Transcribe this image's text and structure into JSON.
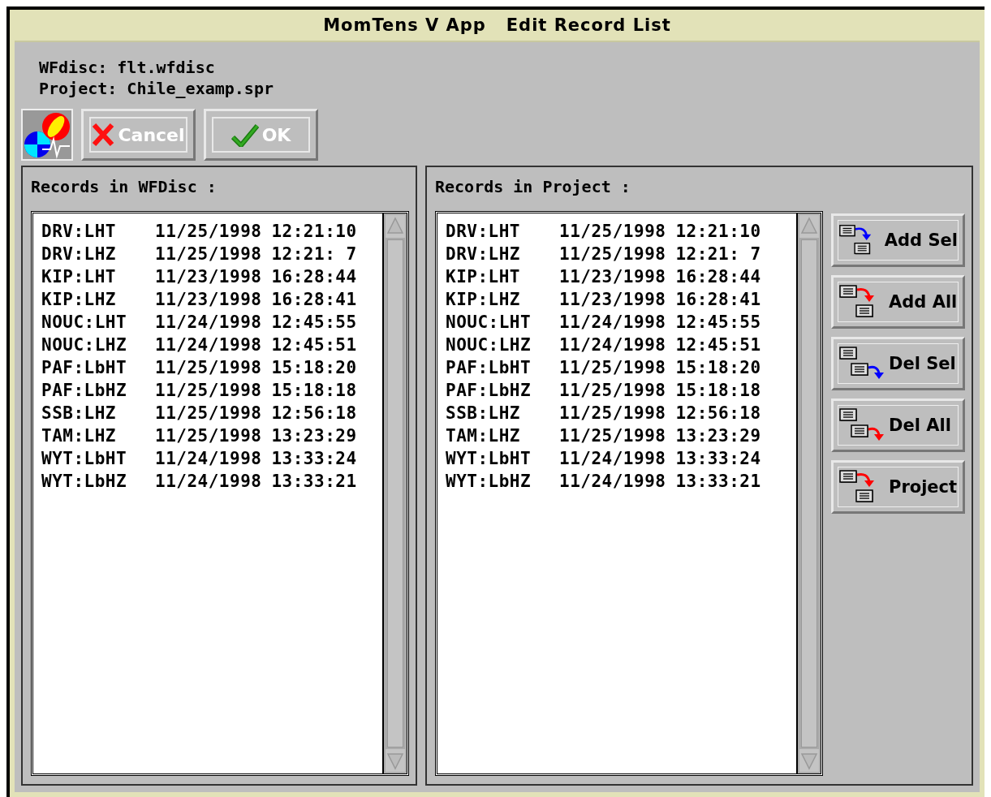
{
  "window": {
    "title": "MomTens V App   Edit Record List"
  },
  "info": [
    {
      "label": "WFdisc:",
      "value": "flt.wfdisc"
    },
    {
      "label": "Project:",
      "value": "Chile_examp.spr"
    }
  ],
  "toolbar": [
    {
      "label": "Cancel",
      "kind": "cancel"
    },
    {
      "label": "OK",
      "kind": "ok"
    }
  ],
  "wfdisc_list": {
    "title": "Records in WFDisc :",
    "rows": [
      {
        "station": "DRV:LHT",
        "date": "11/25/1998",
        "time": "12:21:10"
      },
      {
        "station": "DRV:LHZ",
        "date": "11/25/1998",
        "time": "12:21: 7"
      },
      {
        "station": "KIP:LHT",
        "date": "11/23/1998",
        "time": "16:28:44"
      },
      {
        "station": "KIP:LHZ",
        "date": "11/23/1998",
        "time": "16:28:41"
      },
      {
        "station": "NOUC:LHT",
        "date": "11/24/1998",
        "time": "12:45:55"
      },
      {
        "station": "NOUC:LHZ",
        "date": "11/24/1998",
        "time": "12:45:51"
      },
      {
        "station": "PAF:LbHT",
        "date": "11/25/1998",
        "time": "15:18:20"
      },
      {
        "station": "PAF:LbHZ",
        "date": "11/25/1998",
        "time": "15:18:18"
      },
      {
        "station": "SSB:LHZ",
        "date": "11/25/1998",
        "time": "12:56:18"
      },
      {
        "station": "TAM:LHZ",
        "date": "11/25/1998",
        "time": "13:23:29"
      },
      {
        "station": "WYT:LbHT",
        "date": "11/24/1998",
        "time": "13:33:24"
      },
      {
        "station": "WYT:LbHZ",
        "date": "11/24/1998",
        "time": "13:33:21"
      }
    ]
  },
  "project_list": {
    "title": "Records in Project :",
    "rows": [
      {
        "station": "DRV:LHT",
        "date": "11/25/1998",
        "time": "12:21:10"
      },
      {
        "station": "DRV:LHZ",
        "date": "11/25/1998",
        "time": "12:21: 7"
      },
      {
        "station": "KIP:LHT",
        "date": "11/23/1998",
        "time": "16:28:44"
      },
      {
        "station": "KIP:LHZ",
        "date": "11/23/1998",
        "time": "16:28:41"
      },
      {
        "station": "NOUC:LHT",
        "date": "11/24/1998",
        "time": "12:45:55"
      },
      {
        "station": "NOUC:LHZ",
        "date": "11/24/1998",
        "time": "12:45:51"
      },
      {
        "station": "PAF:LbHT",
        "date": "11/25/1998",
        "time": "15:18:20"
      },
      {
        "station": "PAF:LbHZ",
        "date": "11/25/1998",
        "time": "15:18:18"
      },
      {
        "station": "SSB:LHZ",
        "date": "11/25/1998",
        "time": "12:56:18"
      },
      {
        "station": "TAM:LHZ",
        "date": "11/25/1998",
        "time": "13:23:29"
      },
      {
        "station": "WYT:LbHT",
        "date": "11/24/1998",
        "time": "13:33:24"
      },
      {
        "station": "WYT:LbHZ",
        "date": "11/24/1998",
        "time": "13:33:21"
      }
    ]
  },
  "actions": [
    {
      "label": "Add Sel",
      "kind": "add",
      "color": "#0000ff"
    },
    {
      "label": "Add All",
      "kind": "add",
      "color": "#ff0000"
    },
    {
      "label": "Del Sel",
      "kind": "del",
      "color": "#0000ff"
    },
    {
      "label": "Del All",
      "kind": "del",
      "color": "#ff0000"
    },
    {
      "label": "Project",
      "kind": "add",
      "color": "#ff0000"
    }
  ]
}
